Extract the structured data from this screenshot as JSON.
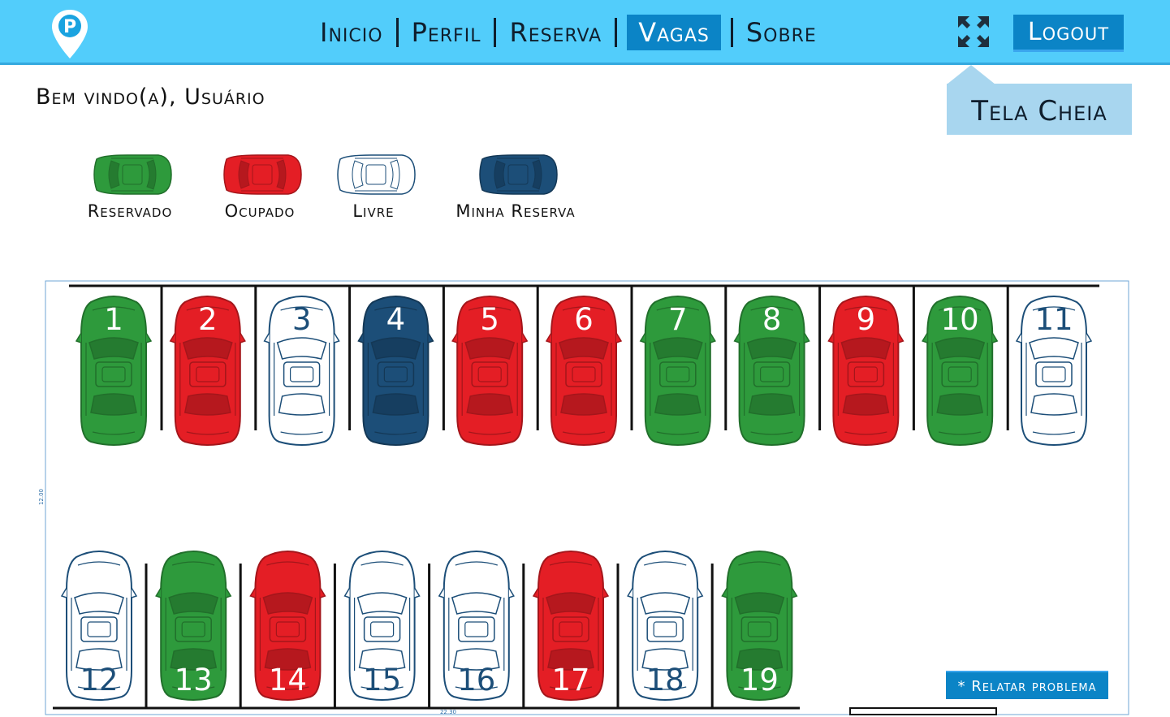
{
  "nav": {
    "items": [
      {
        "label": "Inicio",
        "active": false
      },
      {
        "label": "Perfil",
        "active": false
      },
      {
        "label": "Reserva",
        "active": false
      },
      {
        "label": "Vagas",
        "active": true
      },
      {
        "label": "Sobre",
        "active": false
      }
    ],
    "logout_label": "Logout",
    "fullscreen_icon": "expand-arrows-icon",
    "logo_icon": "parking-pin-icon"
  },
  "welcome": "Bem vindo(a), Usuário",
  "tooltip": "Tela Cheia",
  "colors": {
    "reservado": "#2e9a3c",
    "ocupado": "#e41e25",
    "livre": "#ffffff",
    "minha": "#1c4e78",
    "header": "#52cdfb",
    "accent": "#0b84c6"
  },
  "legend": [
    {
      "status": "reservado",
      "label": "Reservado"
    },
    {
      "status": "ocupado",
      "label": "Ocupado"
    },
    {
      "status": "livre",
      "label": "Livre"
    },
    {
      "status": "minha",
      "label": "Minha Reserva"
    }
  ],
  "spots": {
    "top": [
      {
        "number": "1",
        "status": "reservado"
      },
      {
        "number": "2",
        "status": "ocupado"
      },
      {
        "number": "3",
        "status": "livre"
      },
      {
        "number": "4",
        "status": "minha"
      },
      {
        "number": "5",
        "status": "ocupado"
      },
      {
        "number": "6",
        "status": "ocupado"
      },
      {
        "number": "7",
        "status": "reservado"
      },
      {
        "number": "8",
        "status": "reservado"
      },
      {
        "number": "9",
        "status": "ocupado"
      },
      {
        "number": "10",
        "status": "reservado"
      },
      {
        "number": "11",
        "status": "livre"
      }
    ],
    "bottom": [
      {
        "number": "12",
        "status": "livre"
      },
      {
        "number": "13",
        "status": "reservado"
      },
      {
        "number": "14",
        "status": "ocupado"
      },
      {
        "number": "15",
        "status": "livre"
      },
      {
        "number": "16",
        "status": "livre"
      },
      {
        "number": "17",
        "status": "ocupado"
      },
      {
        "number": "18",
        "status": "livre"
      },
      {
        "number": "19",
        "status": "reservado"
      }
    ]
  },
  "dimensions": {
    "height_label": "12.00",
    "width_label": "22.30"
  },
  "report_label": "* Relatar problema"
}
